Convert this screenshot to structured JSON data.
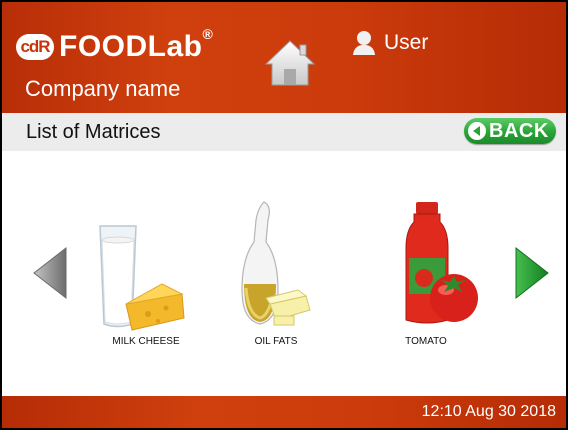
{
  "header": {
    "logo_badge": "cdR",
    "logo_text": "FOODLab",
    "logo_reg": "®",
    "company": "Company name",
    "user_label": "User"
  },
  "title_bar": {
    "title": "List of Matrices",
    "back_label": "BACK"
  },
  "matrices": [
    {
      "label": "MILK CHEESE",
      "icon": "milk-cheese-icon"
    },
    {
      "label": "OIL FATS",
      "icon": "oil-fats-icon"
    },
    {
      "label": "TOMATO",
      "icon": "tomato-icon"
    }
  ],
  "footer": {
    "datetime": "12:10  Aug 30 2018"
  },
  "colors": {
    "header": "#cc3b0b",
    "back_button": "#28a436",
    "nav_left": "#8a8a8a",
    "nav_right": "#1f9a2f"
  }
}
